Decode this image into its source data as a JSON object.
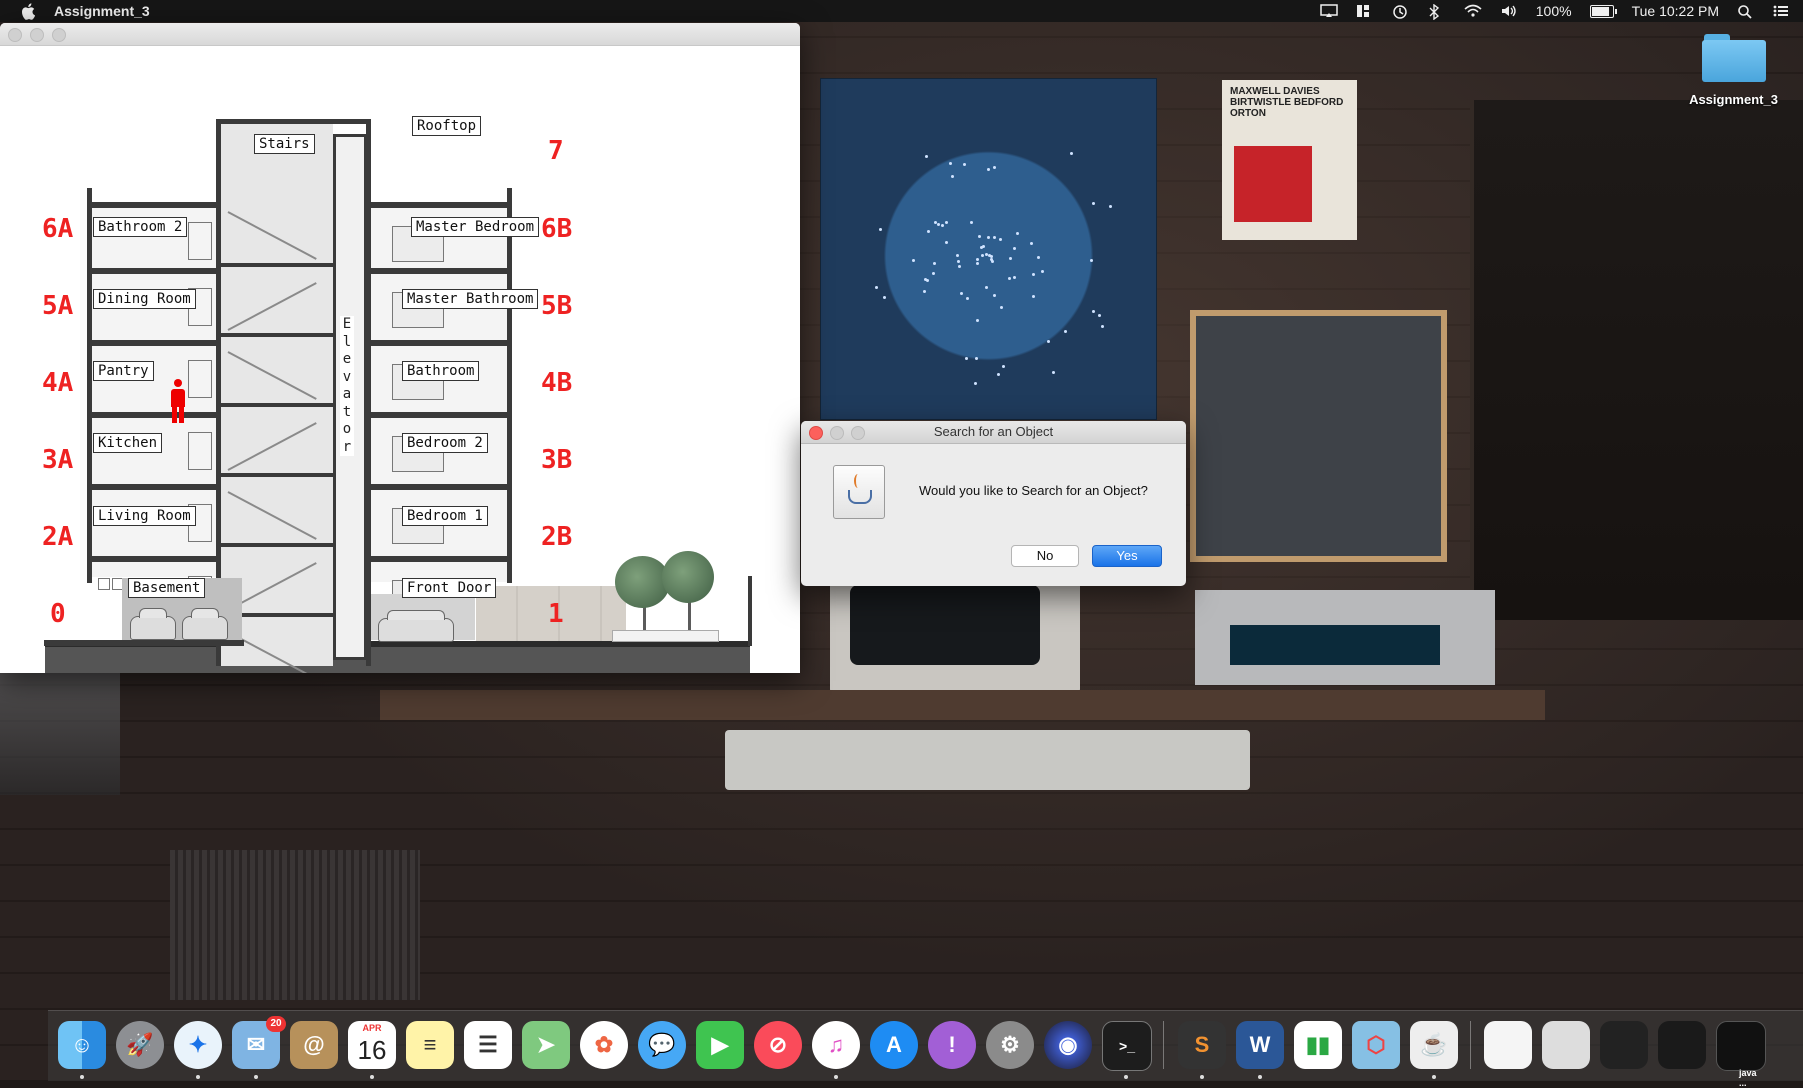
{
  "menubar": {
    "app_name": "Assignment_3",
    "battery_percent": "100%",
    "clock": "Tue 10:22 PM",
    "icons": [
      "apple-icon",
      "cast-icon",
      "grid-icon",
      "time-machine-icon",
      "bluetooth-icon",
      "wifi-icon",
      "volume-icon",
      "battery-icon"
    ]
  },
  "desktop": {
    "folder_label": "Assignment_3"
  },
  "wallpaper": {
    "poster_text": "MAXWELL DAVIES BIRTWISTLE BEDFORD ORTON"
  },
  "building": {
    "top_labels": {
      "stairs": "Stairs",
      "rooftop": "Rooftop"
    },
    "elevator_letters": [
      "E",
      "l",
      "e",
      "v",
      "a",
      "t",
      "o",
      "r"
    ],
    "left_rooms": [
      "Bathroom 2",
      "Dining Room",
      "Pantry",
      "Kitchen",
      "Living Room",
      "Basement"
    ],
    "right_rooms": [
      "Master Bedroom",
      "Master Bathroom",
      "Bathroom",
      "Bedroom 2",
      "Bedroom 1",
      "Front Door"
    ],
    "left_floors": [
      "6A",
      "5A",
      "4A",
      "3A",
      "2A",
      "0"
    ],
    "right_floors": [
      "7",
      "6B",
      "5B",
      "4B",
      "3B",
      "2B",
      "1"
    ],
    "person_room": "Pantry",
    "accent_color": "#e22222"
  },
  "dialog": {
    "title": "Search for an Object",
    "message": "Would you like to Search for an Object?",
    "no_label": "No",
    "yes_label": "Yes",
    "icon": "java-icon"
  },
  "dock": {
    "items": [
      "Finder",
      "Launchpad",
      "Safari",
      "Mail",
      "Contacts",
      "Calendar",
      "Notes",
      "Reminders",
      "Maps",
      "Photos",
      "Messages",
      "FaceTime",
      "News",
      "iTunes",
      "App Store",
      "Feedback Assistant",
      "System Preferences",
      "Siri",
      "Terminal",
      "Sublime Text",
      "Word",
      "Numbers",
      "Spyder",
      "Java"
    ],
    "mail_badge": "20",
    "calendar_month": "APR",
    "calendar_day": "16",
    "thumb_label": "java ..."
  }
}
